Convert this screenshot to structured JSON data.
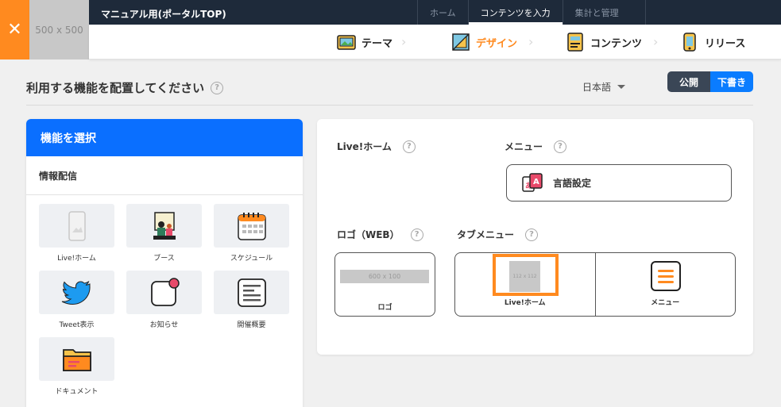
{
  "header": {
    "logo_placeholder": "500 x 500",
    "app_title": "マニュアル用(ポータルTOP)",
    "top_nav": [
      "ホーム",
      "コンテンツを入力",
      "集計と管理"
    ],
    "top_nav_active": "コンテンツを入力",
    "steps": [
      {
        "label": "テーマ",
        "icon": "theme-icon"
      },
      {
        "label": "デザイン",
        "icon": "design-icon",
        "active": true
      },
      {
        "label": "コンテンツ",
        "icon": "contents-icon"
      },
      {
        "label": "リリース",
        "icon": "release-icon"
      }
    ]
  },
  "section": {
    "title": "利用する機能を配置してください",
    "language": "日本語",
    "publish_label": "公開",
    "draft_label": "下書き"
  },
  "features": {
    "header": "機能を選択",
    "category": "情報配信",
    "items": [
      {
        "label": "Live!ホーム",
        "icon": "phone-icon"
      },
      {
        "label": "ブース",
        "icon": "booth-icon"
      },
      {
        "label": "スケジュール",
        "icon": "calendar-icon"
      },
      {
        "label": "Tweet表示",
        "icon": "twitter-icon"
      },
      {
        "label": "お知らせ",
        "icon": "notification-icon"
      },
      {
        "label": "開催概要",
        "icon": "overview-icon"
      },
      {
        "label": "ドキュメント",
        "icon": "folder-icon"
      }
    ]
  },
  "layout": {
    "live_home_label": "Live!ホーム",
    "menu_label": "メニュー",
    "language_button": "言語設定",
    "logo_label": "ロゴ（WEB）",
    "logo_placeholder": "600 x 100",
    "logo_caption": "ロゴ",
    "tab_menu_label": "タブメニュー",
    "tabs": [
      {
        "label": "Live!ホーム",
        "placeholder": "112 x 112"
      },
      {
        "label": "メニュー"
      }
    ]
  },
  "colors": {
    "accent_orange": "#ff8a1f",
    "brand_blue": "#0a6fff",
    "navy": "#1e2a3a"
  }
}
